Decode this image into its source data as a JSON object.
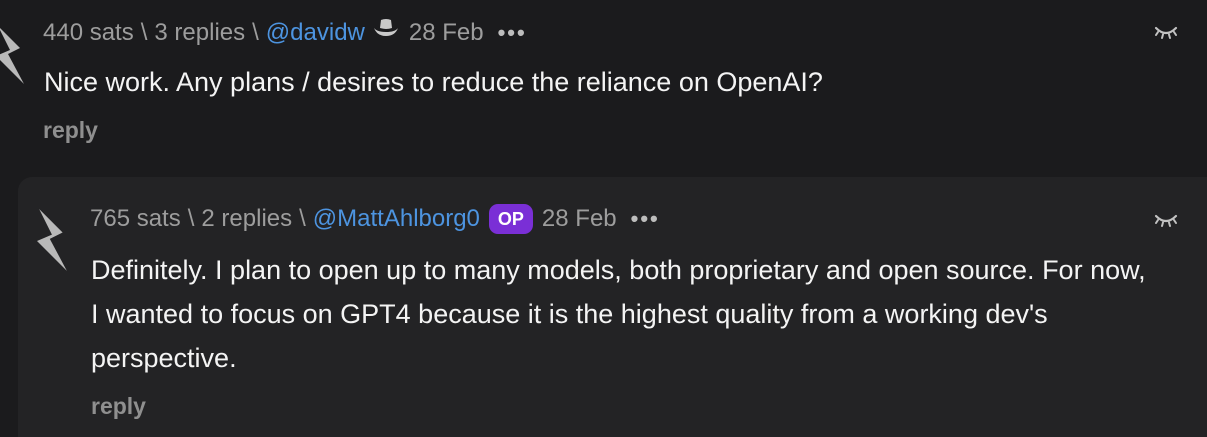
{
  "comments": [
    {
      "sats": "440 sats",
      "replies": "3 replies",
      "separator": "\\",
      "username": "@davidw",
      "hat_icon": "cowboy-hat-icon",
      "date": "28 Feb",
      "more": "•••",
      "text": "Nice work. Any plans / desires to reduce the reliance on OpenAI?",
      "reply_label": "reply"
    },
    {
      "sats": "765 sats",
      "replies": "2 replies",
      "separator": "\\",
      "username": "@MattAhlborg0",
      "badge": "OP",
      "date": "28 Feb",
      "more": "•••",
      "text": "Definitely. I plan to open up to many models, both proprietary and open source. For now, I wanted to focus on GPT4 because it is the highest quality from a working dev's perspective.",
      "reply_label": "reply"
    }
  ],
  "colors": {
    "background": "#1b1b1d",
    "nested_background": "#232325",
    "meta_text": "#9d9d9d",
    "username": "#4d94e0",
    "op_badge": "#7a2fd6"
  }
}
